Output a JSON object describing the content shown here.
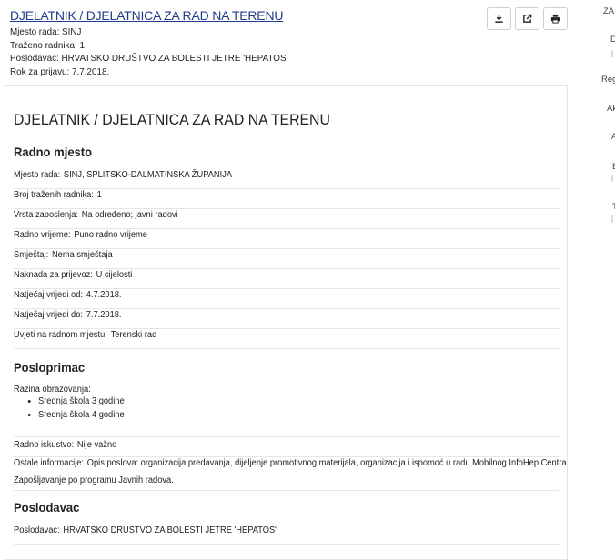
{
  "summary": {
    "title": "DJELATNIK / DJELATNICA ZA RAD NA TERENU",
    "lines": [
      "Mjesto rada: SINJ",
      "Traženo radnika: 1",
      "Poslodavac: HRVATSKO DRUŠTVO ZA BOLESTI JETRE 'HEPATOS'",
      "Rok za prijavu: 7.7.2018."
    ]
  },
  "actions": {
    "icons": [
      "download-icon",
      "external-link-icon",
      "print-icon"
    ]
  },
  "sidebar": {
    "items": [
      "ZAŠ",
      "D",
      "Regi",
      "Ak",
      "A",
      "E",
      "T"
    ]
  },
  "detail": {
    "title": "DJELATNIK / DJELATNICA ZA RAD NA TERENU",
    "radno_mjesto": {
      "heading": "Radno mjesto",
      "rows": [
        {
          "label": "Mjesto rada:",
          "value": "SINJ, SPLITSKO-DALMATINSKA ŽUPANIJA"
        },
        {
          "label": "Broj traženih radnika:",
          "value": "1"
        },
        {
          "label": "Vrsta zaposlenja:",
          "value": "Na određeno; javni radovi"
        },
        {
          "label": "Radno vrijeme:",
          "value": "Puno radno vrijeme"
        },
        {
          "label": "Smještaj:",
          "value": "Nema smještaja"
        },
        {
          "label": "Naknada za prijevoz:",
          "value": "U cijelosti"
        },
        {
          "label": "Natječaj vrijedi od:",
          "value": "4.7.2018."
        },
        {
          "label": "Natječaj vrijedi do:",
          "value": "7.7.2018."
        },
        {
          "label": "Uvjeti na radnom mjestu:",
          "value": "Terenski rad"
        }
      ]
    },
    "posloprimac": {
      "heading": "Posloprimac",
      "razina_label": "Razina obrazovanja:",
      "razina_items": [
        "Srednja škola 3 godine",
        "Srednja škola 4 godine"
      ],
      "iskustvo_label": "Radno iskustvo:",
      "iskustvo_value": "Nije važno",
      "ostale_label": "Ostale informacije:",
      "ostale_value": "Opis poslova: organizacija predavanja, dijeljenje promotivnog materijala, organizacija i ispomoć u radu Mobilnog InfoHep Centra.",
      "ostale_extra": "Zapošljavanje po programu Javnih radova."
    },
    "poslodavac": {
      "heading": "Poslodavac",
      "label": "Poslodavac:",
      "value": "HRVATSKO DRUŠTVO ZA BOLESTI JETRE 'HEPATOS'"
    }
  }
}
